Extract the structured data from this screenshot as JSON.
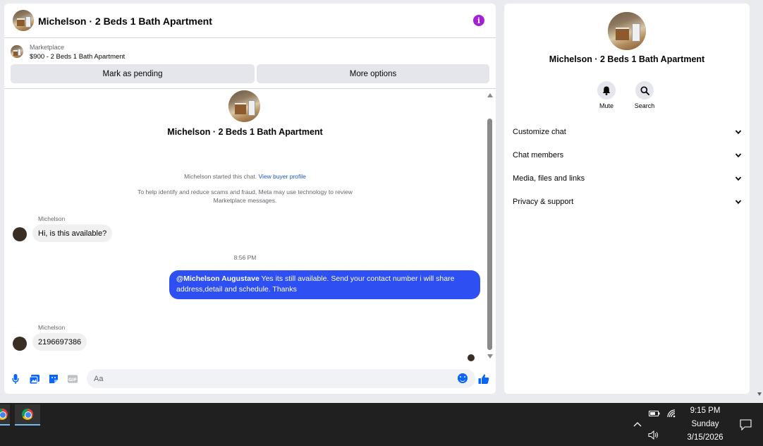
{
  "chat": {
    "header_title": "Michelson · 2 Beds 1 Bath Apartment",
    "listing_label": "Marketplace",
    "listing_price": "$900 - 2 Beds 1 Bath Apartment",
    "mark_pending_label": "Mark as pending",
    "more_options_label": "More options",
    "conversation_title": "Michelson · 2 Beds 1 Bath Apartment",
    "started_text": "Michelson started this chat.",
    "view_buyer_profile": "View buyer profile",
    "safety_notice_1": "To help identify and reduce scams and fraud, Meta may use technology to review",
    "safety_notice_2": "Marketplace messages.",
    "messages": [
      {
        "sender": "Michelson",
        "text": "Hi, is this available?"
      },
      {
        "timestamp": "8:56 PM"
      },
      {
        "mention": "@Michelson Augustave",
        "text_line1": " Yes its still available. Send your contact number i will share",
        "text_line2": "address,detail and schedule. Thanks"
      },
      {
        "sender": "Michelson",
        "text": "2196697386"
      }
    ],
    "composer_placeholder": "Aa"
  },
  "details": {
    "title": "Michelson · 2 Beds 1 Bath Apartment",
    "actions": [
      {
        "label": "Mute",
        "icon": "bell-icon"
      },
      {
        "label": "Search",
        "icon": "search-icon"
      }
    ],
    "menu": [
      {
        "label": "Customize chat"
      },
      {
        "label": "Chat members"
      },
      {
        "label": "Media, files and links"
      },
      {
        "label": "Privacy & support"
      }
    ]
  },
  "taskbar": {
    "time": "9:15 PM",
    "day": "Sunday",
    "date": "3/15/2026"
  },
  "colors": {
    "accent_blue": "#0866ff",
    "outgoing_bubble": "#2e4ff2",
    "info_purple": "#a51fd6",
    "taskbar_bg": "#202020"
  }
}
